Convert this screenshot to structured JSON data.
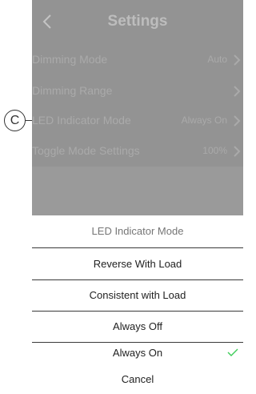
{
  "header": {
    "title": "Settings"
  },
  "settings": [
    {
      "label": "Dimming Mode",
      "value": "Auto"
    },
    {
      "label": "Dimming Range",
      "value": ""
    },
    {
      "label": "LED Indicator Mode",
      "value": "Always On"
    },
    {
      "label": "Toggle Mode Settings",
      "value": "100%"
    }
  ],
  "sheet": {
    "title": "LED Indicator Mode",
    "options": [
      "Reverse With Load",
      "Consistent with Load",
      "Always Off",
      "Always On"
    ],
    "selected": "Always On",
    "cancel": "Cancel"
  },
  "callout": {
    "label": "C"
  },
  "icons": {
    "back": "chevron-left-icon",
    "row": "chevron-right-icon",
    "selected": "checkmark-icon"
  },
  "colors": {
    "accent": "#3dcd58",
    "overlay": "#9a9a9a"
  }
}
